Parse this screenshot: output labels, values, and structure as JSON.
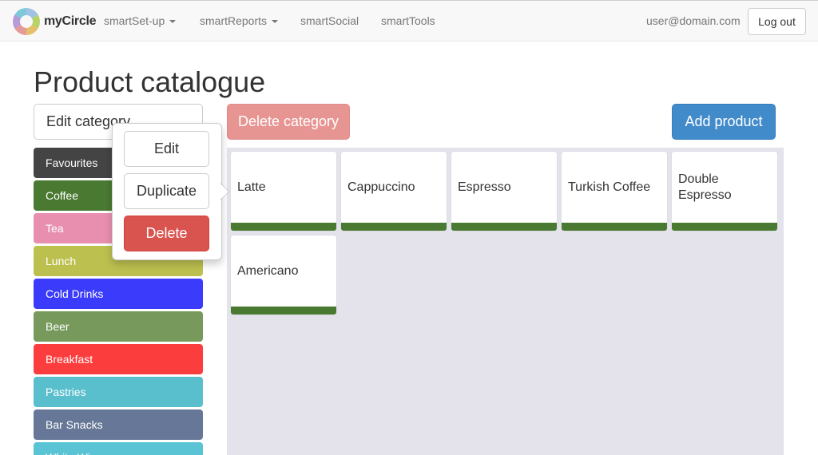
{
  "navbar": {
    "brand": "myCircle",
    "menu": [
      {
        "label": "smartSet-up",
        "dropdown": true
      },
      {
        "label": "smartReports",
        "dropdown": true
      },
      {
        "label": "smartSocial",
        "dropdown": false
      },
      {
        "label": "smartTools",
        "dropdown": false
      }
    ],
    "user_email": "user@domain.com",
    "logout_label": "Log out"
  },
  "page": {
    "title": "Product catalogue",
    "edit_category_label": "Edit category",
    "delete_category_label": "Delete category",
    "add_product_label": "Add product"
  },
  "popover": {
    "edit_label": "Edit",
    "duplicate_label": "Duplicate",
    "delete_label": "Delete"
  },
  "categories": [
    {
      "label": "Favourites",
      "color": "#444444"
    },
    {
      "label": "Coffee",
      "color": "#4a7a32"
    },
    {
      "label": "Tea",
      "color": "#e88faf"
    },
    {
      "label": "Lunch",
      "color": "#bcc04f"
    },
    {
      "label": "Cold Drinks",
      "color": "#3b3bfb"
    },
    {
      "label": "Beer",
      "color": "#779a5c"
    },
    {
      "label": "Breakfast",
      "color": "#fc3d3d"
    },
    {
      "label": "Pastries",
      "color": "#5abfcd"
    },
    {
      "label": "Bar Snacks",
      "color": "#667797"
    },
    {
      "label": "White Wine",
      "color": "#5ac4d4"
    }
  ],
  "products": [
    {
      "name": "Latte",
      "color": "#4a7a32"
    },
    {
      "name": "Cappuccino",
      "color": "#4a7a32"
    },
    {
      "name": "Espresso",
      "color": "#4a7a32"
    },
    {
      "name": "Turkish Coffee",
      "color": "#4a7a32"
    },
    {
      "name": "Double Espresso",
      "color": "#4a7a32"
    },
    {
      "name": "Americano",
      "color": "#4a7a32"
    }
  ]
}
